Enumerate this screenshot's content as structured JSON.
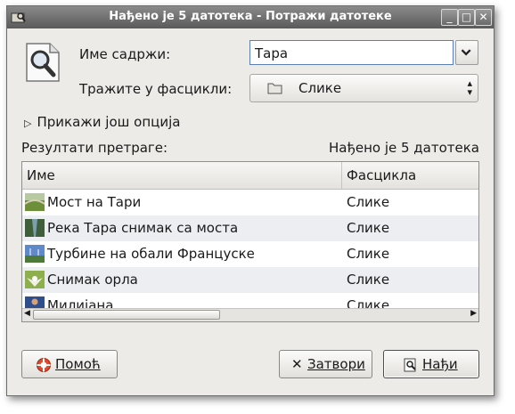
{
  "window": {
    "title": "Нађено је 5 датотека - Потражи датотеке"
  },
  "form": {
    "name_contains_label": "Име садржи:",
    "name_value": "Тара",
    "look_in_label": "Тражите у фасцикли:",
    "folder_value": "Слике",
    "more_options_label": "Прикажи још опција"
  },
  "results": {
    "label": "Резултати претраге:",
    "status": "Нађено је 5 датотека",
    "columns": [
      "Име",
      "Фасцикла"
    ],
    "rows": [
      {
        "name": "Мост на Тари",
        "folder": "Слике",
        "thumb": "bridge-photo"
      },
      {
        "name": "Река Тара снимак са моста",
        "folder": "Слике",
        "thumb": "river-photo"
      },
      {
        "name": "Турбине на обали Француске",
        "folder": "Слике",
        "thumb": "turbines-photo"
      },
      {
        "name": "Снимак орла",
        "folder": "Слике",
        "thumb": "eagle-photo"
      },
      {
        "name": "Милијана",
        "folder": "Слике",
        "thumb": "portrait-photo"
      }
    ]
  },
  "buttons": {
    "help": "Помоћ",
    "close": "Затвори",
    "find": "Нађи"
  }
}
